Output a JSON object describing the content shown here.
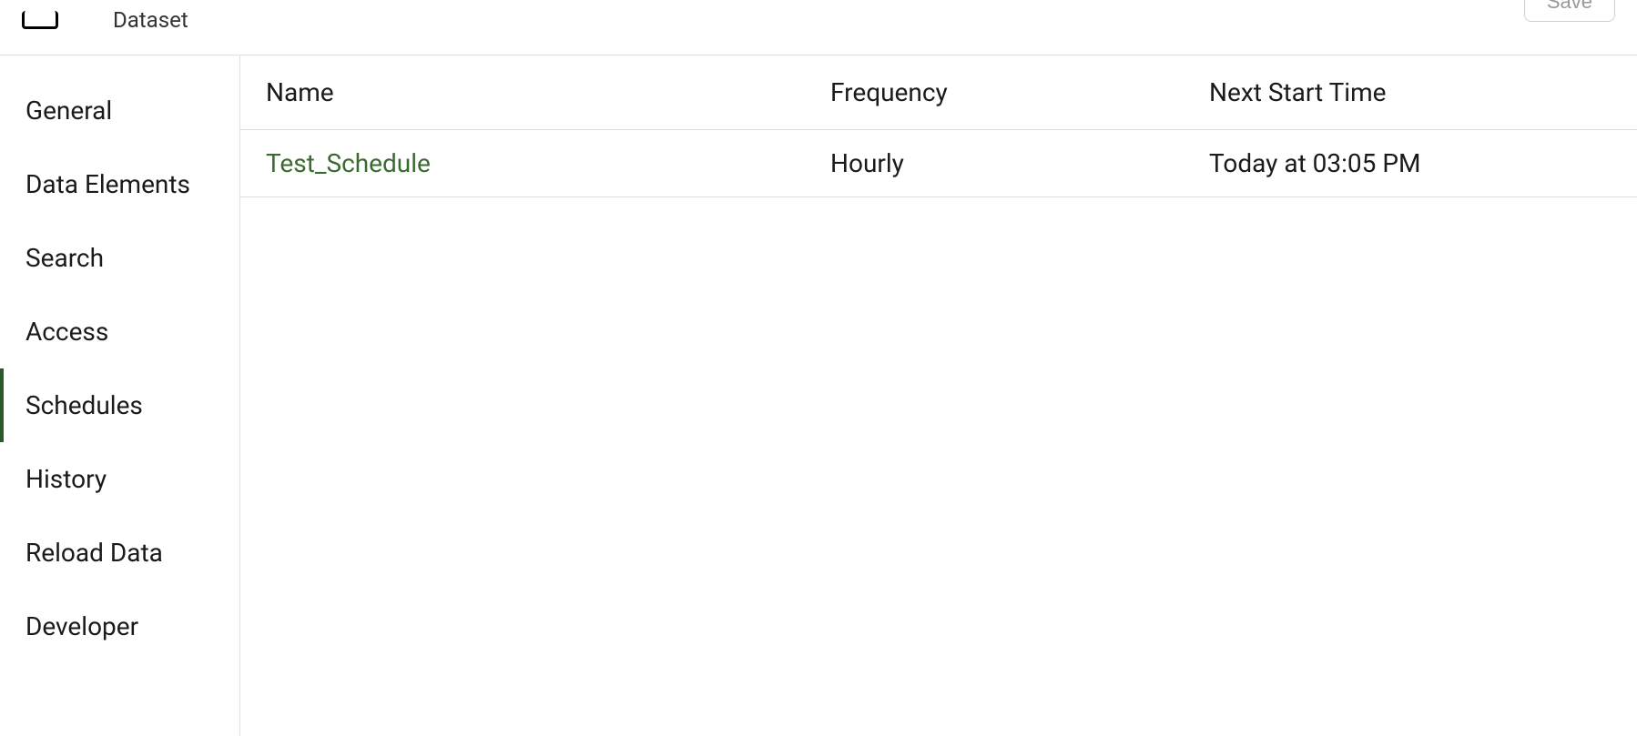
{
  "header": {
    "subtitle": "Dataset",
    "save_label": "Save"
  },
  "sidebar": {
    "items": [
      {
        "label": "General",
        "active": false
      },
      {
        "label": "Data Elements",
        "active": false
      },
      {
        "label": "Search",
        "active": false
      },
      {
        "label": "Access",
        "active": false
      },
      {
        "label": "Schedules",
        "active": true
      },
      {
        "label": "History",
        "active": false
      },
      {
        "label": "Reload Data",
        "active": false
      },
      {
        "label": "Developer",
        "active": false
      }
    ]
  },
  "table": {
    "columns": {
      "name": "Name",
      "frequency": "Frequency",
      "next_start": "Next Start Time"
    },
    "rows": [
      {
        "name": "Test_Schedule",
        "frequency": "Hourly",
        "next_start": "Today at 03:05 PM"
      }
    ]
  }
}
